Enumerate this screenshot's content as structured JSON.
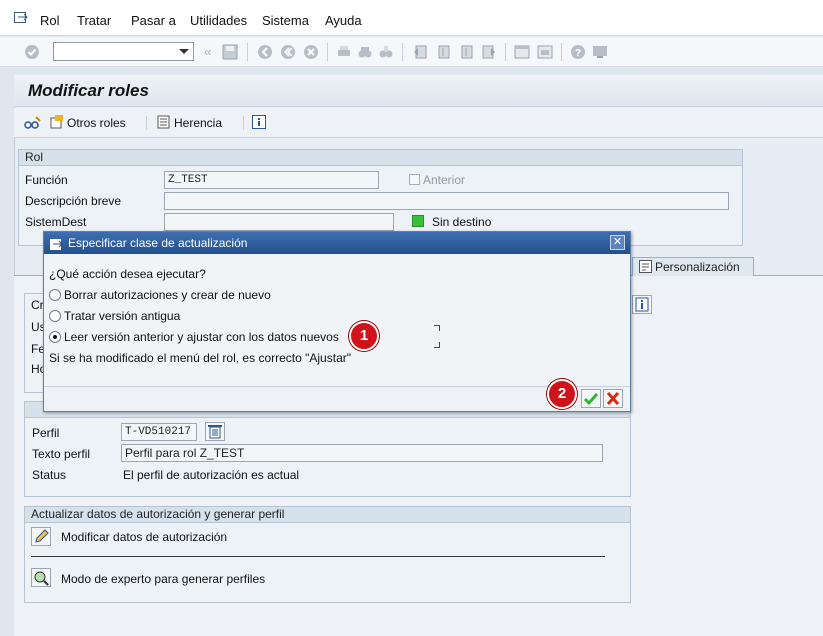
{
  "menu": {
    "items": [
      {
        "label": "Rol"
      },
      {
        "label": "Tratar"
      },
      {
        "label": "Pasar a"
      },
      {
        "label": "Utilidades"
      },
      {
        "label": "Sistema"
      },
      {
        "label": "Ayuda"
      }
    ]
  },
  "header": {
    "title": "Modificar roles"
  },
  "app_toolbar": {
    "otros_roles": "Otros roles",
    "herencia": "Herencia"
  },
  "rol_group": {
    "title": "Rol",
    "funcion_label": "Función",
    "funcion_value": "Z_TEST",
    "anterior_label": "Anterior",
    "descripcion_label": "Descripción breve",
    "sistemdest_label": "SistemDest",
    "sin_destino": "Sin destino"
  },
  "tabs": {
    "personalizacion": "Personalización"
  },
  "dialog": {
    "title": "Especificar clase de actualización",
    "question": "¿Qué acción desea ejecutar?",
    "options": [
      {
        "label": "Borrar autorizaciones y crear de nuevo",
        "selected": false
      },
      {
        "label": "Tratar versión antigua",
        "selected": false
      },
      {
        "label": "Leer versión anterior y ajustar con los datos nuevos",
        "selected": true
      }
    ],
    "hint": "Si se ha modificado el menú del rol, es correcto \"Ajustar\"",
    "badge1": "1",
    "badge2": "2"
  },
  "behind": {
    "cr_label": "Cr",
    "us_label": "Us",
    "fe_label": "Fe",
    "ho_label": "Ho"
  },
  "perfil_group": {
    "perfil_label": "Perfil",
    "perfil_value": "T-VD510217",
    "texto_label": "Texto perfil",
    "texto_value": "Perfil para rol Z_TEST",
    "status_label": "Status",
    "status_value": "El perfil de autorización es actual"
  },
  "actualizar_group": {
    "title": "Actualizar datos de autorización y generar perfil",
    "modificar": "Modificar datos de autorización",
    "experto": "Modo de experto para generar perfiles"
  },
  "colors": {
    "accent": "#2a5596",
    "badge": "#d0121b",
    "ok_green": "#2fb52f",
    "cancel_red": "#d92b12"
  }
}
